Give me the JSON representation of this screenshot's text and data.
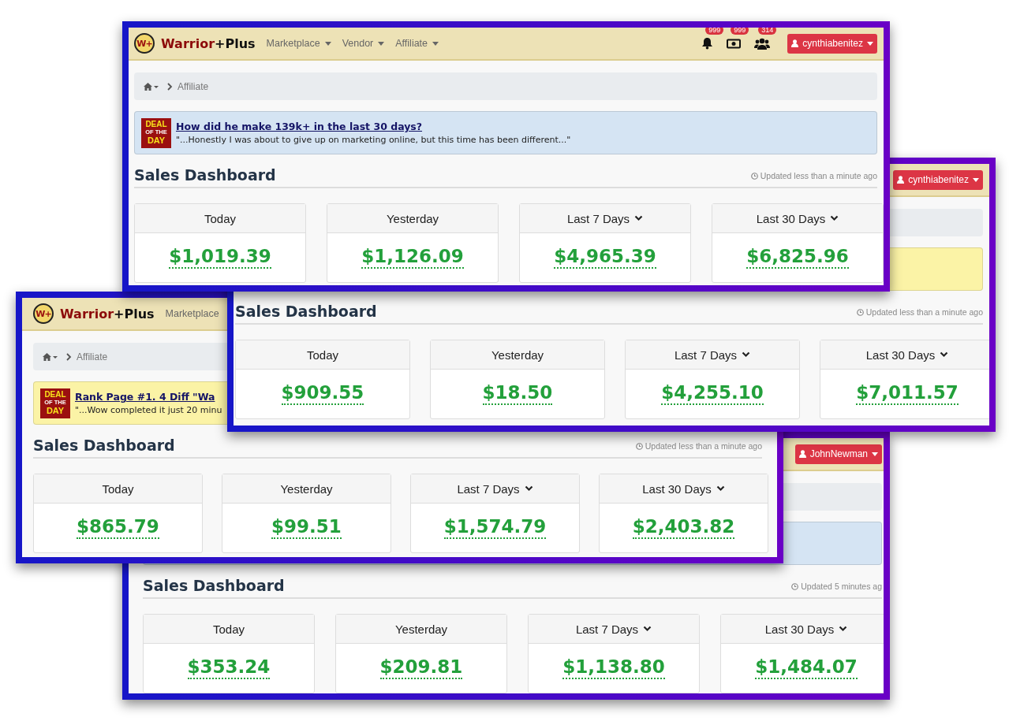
{
  "screens": [
    {
      "header": {
        "logo": "W+",
        "brand": [
          "Warrior",
          "+Plus"
        ],
        "nav": [
          {
            "label": "Marketplace",
            "dropdown": true
          },
          {
            "label": "Vendor",
            "dropdown": true
          },
          {
            "label": "Affiliate",
            "dropdown": true
          }
        ],
        "notifications": [
          {
            "kind": "bell",
            "count": "999"
          },
          {
            "kind": "money",
            "count": "999"
          },
          {
            "kind": "users",
            "count": "314"
          }
        ],
        "user": "cynthiabenitez"
      },
      "breadcrumb": {
        "current": "Affiliate"
      },
      "deal": {
        "color": "#d5e4f3",
        "badge": [
          "DEAL",
          "OF THE",
          "DAY"
        ],
        "title": "How did he make 139k+ in the last 30 days?",
        "quote": "\"...Honestly I was about to give up on marketing online, but this time has been different...\""
      },
      "dashboard": {
        "title": "Sales Dashboard",
        "updated": "Updated less than a minute ago",
        "cards": [
          {
            "label": "Today",
            "value": "$1,019.39",
            "dropdown": false
          },
          {
            "label": "Yesterday",
            "value": "$1,126.09",
            "dropdown": false
          },
          {
            "label": "Last 7 Days",
            "value": "$4,965.39",
            "dropdown": true
          },
          {
            "label": "Last 30 Days",
            "value": "$6,825.96",
            "dropdown": true
          }
        ]
      }
    },
    {
      "header": {
        "user": "cynthiabenitez"
      },
      "deal": {
        "color": "#fbf3a6"
      },
      "dashboard": {
        "title": "Sales Dashboard",
        "updated": "Updated less than a minute ago",
        "cards": [
          {
            "label": "Today",
            "value": "$909.55",
            "dropdown": false
          },
          {
            "label": "Yesterday",
            "value": "$18.50",
            "dropdown": false
          },
          {
            "label": "Last 7 Days",
            "value": "$4,255.10",
            "dropdown": true
          },
          {
            "label": "Last 30 Days",
            "value": "$7,011.57",
            "dropdown": true
          }
        ]
      }
    },
    {
      "header": {
        "logo": "W+",
        "brand": [
          "Warrior",
          "+Plus"
        ],
        "nav": [
          {
            "label": "Marketplace",
            "dropdown": false
          }
        ]
      },
      "breadcrumb": {
        "current": "Affiliate"
      },
      "deal": {
        "color": "#fbf3a6",
        "badge": [
          "DEAL",
          "OF THE",
          "DAY"
        ],
        "title": "Rank Page #1. 4 Diff \"Wa",
        "quote": "\"...Wow completed it just 20 minu"
      },
      "dashboard": {
        "title": "Sales Dashboard",
        "updated": "Updated less than a minute ago",
        "cards": [
          {
            "label": "Today",
            "value": "$865.79",
            "dropdown": false
          },
          {
            "label": "Yesterday",
            "value": "$99.51",
            "dropdown": false
          },
          {
            "label": "Last 7 Days",
            "value": "$1,574.79",
            "dropdown": true
          },
          {
            "label": "Last 30 Days",
            "value": "$2,403.82",
            "dropdown": true
          }
        ]
      }
    },
    {
      "header": {
        "user": "JohnNewman"
      },
      "deal": {
        "color": "#d5e4f3"
      },
      "dashboard": {
        "title": "Sales Dashboard",
        "updated": "Updated 5 minutes ag",
        "cards": [
          {
            "label": "Today",
            "value": "$353.24",
            "dropdown": false
          },
          {
            "label": "Yesterday",
            "value": "$209.81",
            "dropdown": false
          },
          {
            "label": "Last 7 Days",
            "value": "$1,138.80",
            "dropdown": true
          },
          {
            "label": "Last 30 Days",
            "value": "$1,484.07",
            "dropdown": true
          }
        ]
      }
    }
  ]
}
